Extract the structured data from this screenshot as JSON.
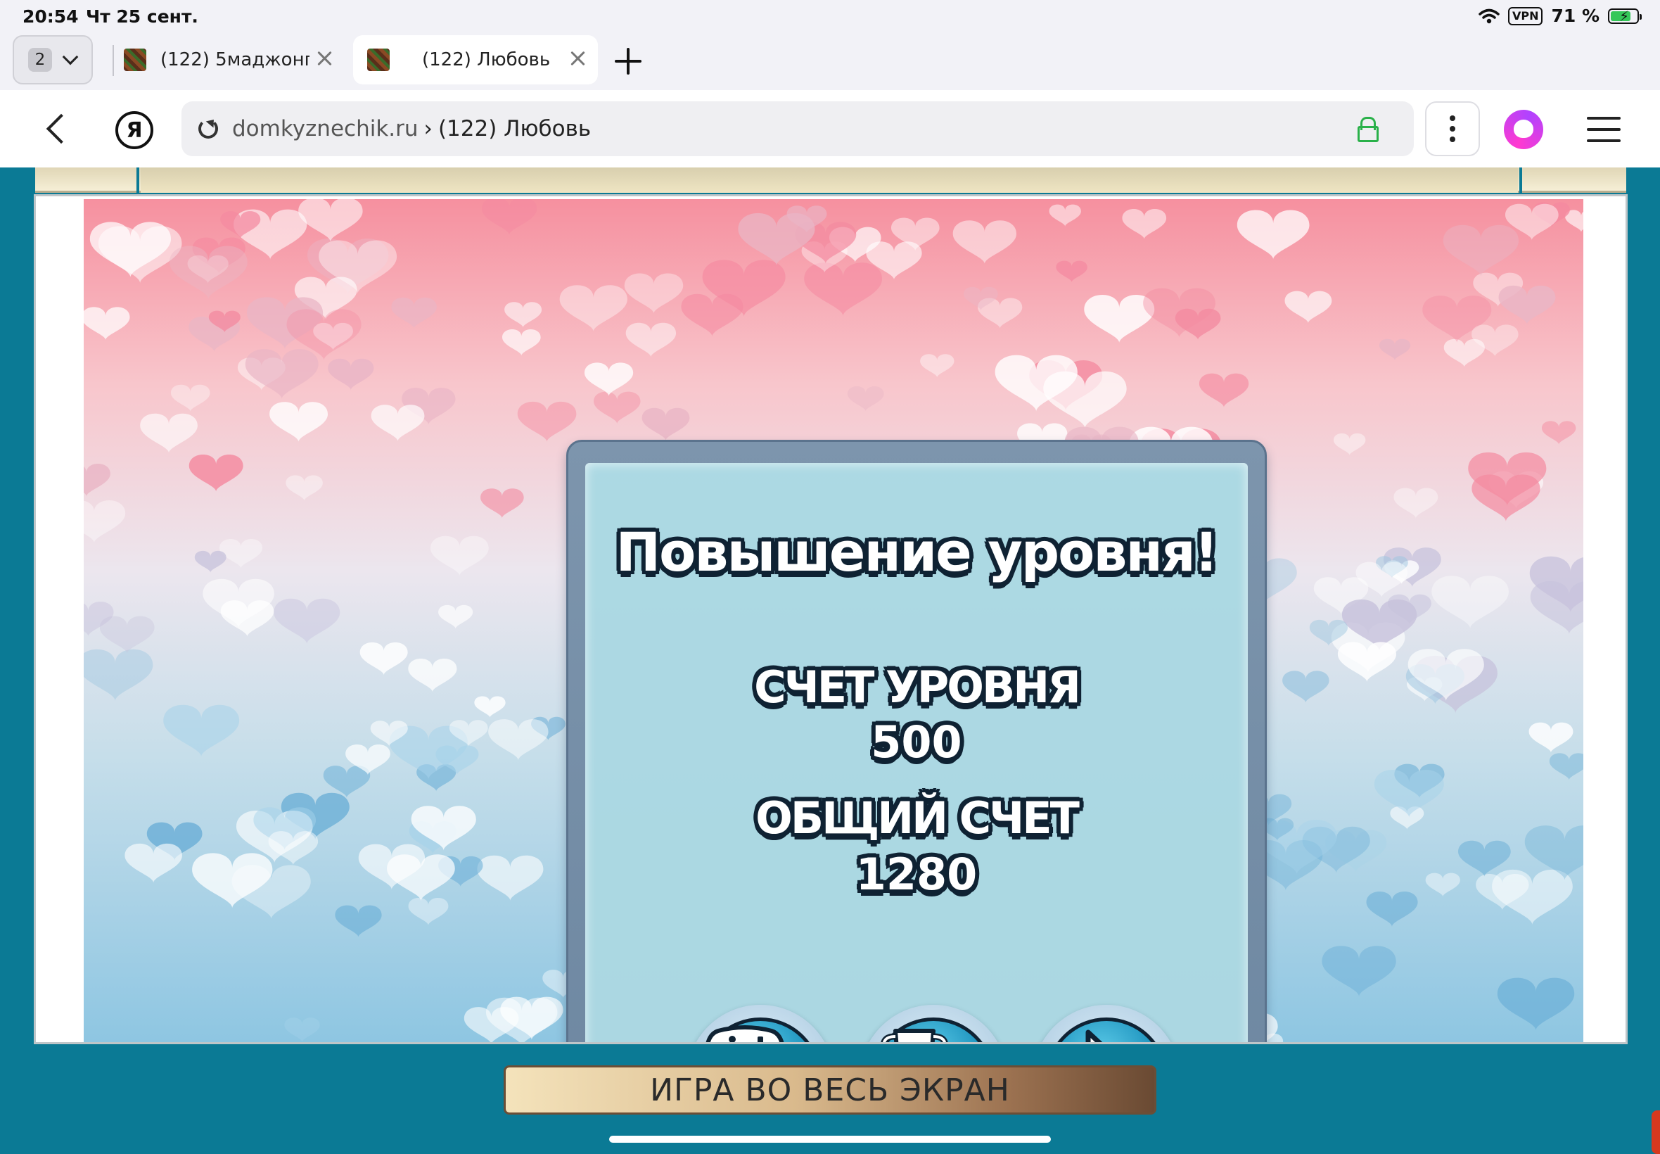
{
  "status_bar": {
    "time": "20:54",
    "date": "Чт 25 сент.",
    "vpn": "VPN",
    "battery": "71 %",
    "icons": [
      "wifi-icon",
      "battery-charging-icon"
    ]
  },
  "tabs": {
    "count": "2",
    "items": [
      {
        "title": "(122) 5маджонг...",
        "active": false
      },
      {
        "title": "(122) Любовь",
        "active": true
      }
    ]
  },
  "address_bar": {
    "browser_logo": "Я",
    "domain": "domkyznechik.ru",
    "separator": "›",
    "page_title": "(122) Любовь",
    "secure": true
  },
  "game": {
    "dialog": {
      "title": "Повышение уровня!",
      "level_score_label": "СЧЕТ УРОВНЯ",
      "level_score_value": "500",
      "total_score_label": "ОБЩИЙ СЧЕТ",
      "total_score_value": "1280",
      "buttons": [
        "gamepad-icon",
        "trophy-icon",
        "arrow-right-icon"
      ]
    },
    "background_theme": "hearts",
    "colors": {
      "frame": "#0b7a95",
      "dialog": "#7d95ad",
      "button": "#1c92bd"
    }
  },
  "fullscreen_button": {
    "label": "ИГРА ВО ВЕСЬ ЭКРАН"
  }
}
